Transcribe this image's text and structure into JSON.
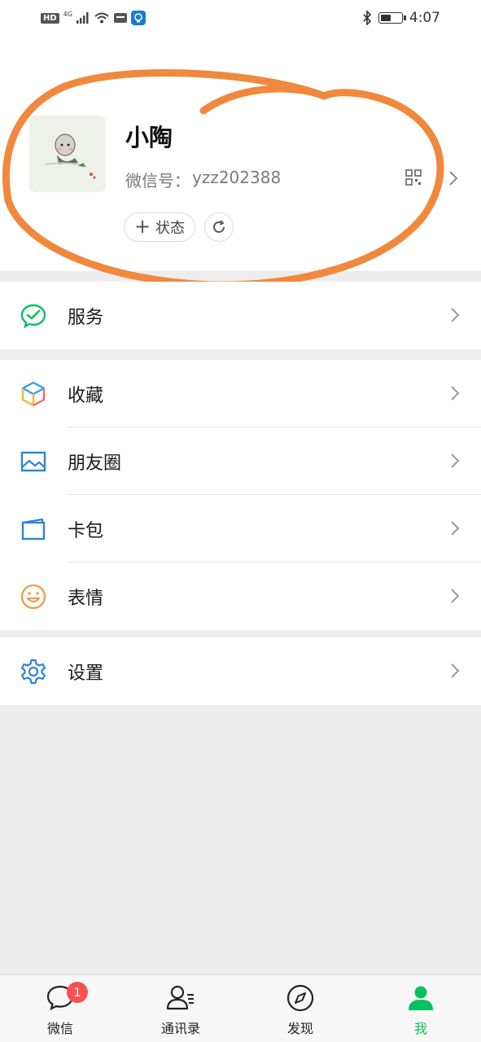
{
  "status_bar": {
    "hd": "HD",
    "network": "4G",
    "time": "4:07",
    "battery_level": 0.55
  },
  "profile": {
    "name": "小陶",
    "wechat_id_label": "微信号：",
    "wechat_id": "yzz202388",
    "status_button": "状态",
    "status_button_icon": "plus-icon",
    "annotation_color": "#f0883e"
  },
  "menu": {
    "service": {
      "label": "服务",
      "icon": "service-icon",
      "color": "#07c160"
    },
    "favorites": {
      "label": "收藏",
      "icon": "favorites-icon"
    },
    "moments": {
      "label": "朋友圈",
      "icon": "moments-icon",
      "color": "#2e84d6"
    },
    "cards": {
      "label": "卡包",
      "icon": "card-wallet-icon",
      "color": "#2e84d6"
    },
    "stickers": {
      "label": "表情",
      "icon": "sticker-icon",
      "color": "#f0a04b"
    },
    "settings": {
      "label": "设置",
      "icon": "settings-icon",
      "color": "#2e84d6"
    }
  },
  "tab_bar": {
    "chats": {
      "label": "微信",
      "badge": "1"
    },
    "contacts": {
      "label": "通讯录"
    },
    "discover": {
      "label": "发现"
    },
    "me": {
      "label": "我",
      "active": true,
      "color": "#07c160"
    }
  }
}
